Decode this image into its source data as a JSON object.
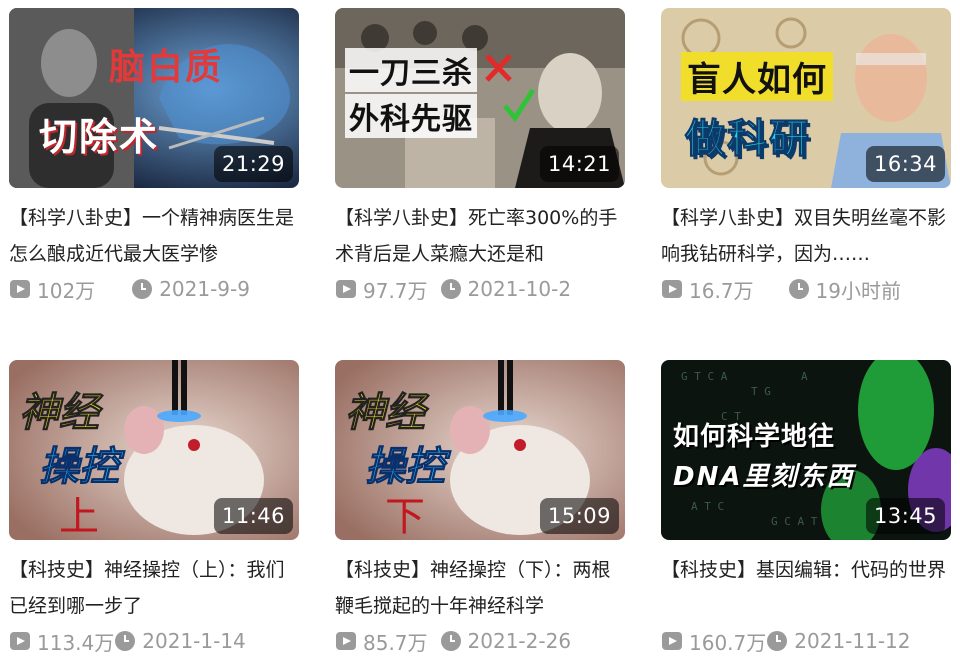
{
  "videos": [
    {
      "title": "【科学八卦史】一个精神病医生是怎么酿成近代最大医学惨",
      "duration": "21:29",
      "views": "102万",
      "date": "2021-9-9",
      "thumb_text": [
        "脑白质",
        "切除术"
      ],
      "thumb_bg": "#2b3d5e"
    },
    {
      "title": "【科学八卦史】死亡率300%的手术背后是人菜瘾大还是和",
      "duration": "14:21",
      "views": "97.7万",
      "date": "2021-10-2",
      "thumb_text": [
        "一刀三杀",
        "外科先驱"
      ],
      "thumb_bg": "#8a8175"
    },
    {
      "title": "【科学八卦史】双目失明丝毫不影响我钻研科学，因为……",
      "duration": "16:34",
      "views": "16.7万",
      "date": "19小时前",
      "thumb_text": [
        "盲人如何",
        "做科研"
      ],
      "thumb_bg": "#d9c9a6"
    },
    {
      "title": "【科技史】神经操控（上）：我们已经到哪一步了",
      "duration": "11:46",
      "views": "113.4万",
      "date": "2021-1-14",
      "thumb_text": [
        "神经",
        "操控",
        "上"
      ],
      "thumb_bg": "#c7a9a0"
    },
    {
      "title": "【科技史】神经操控（下）：两根鞭毛搅起的十年神经科学",
      "duration": "15:09",
      "views": "85.7万",
      "date": "2021-2-26",
      "thumb_text": [
        "神经",
        "操控",
        "下"
      ],
      "thumb_bg": "#c7a9a0"
    },
    {
      "title": "【科技史】基因编辑：代码的世界",
      "duration": "13:45",
      "views": "160.7万",
      "date": "2021-11-12",
      "thumb_text": [
        "如何科学地往",
        "DNA里刻东西"
      ],
      "thumb_bg": "#0c1410"
    }
  ],
  "icons": {
    "views": "play-count-icon",
    "date": "clock-icon"
  },
  "colors": {
    "meta_text": "#9a9a9a",
    "title_text": "#222222"
  }
}
